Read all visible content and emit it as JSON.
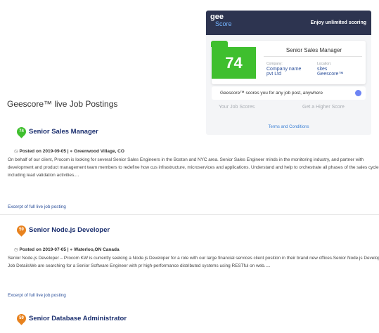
{
  "promo": {
    "logo_line1": "gee",
    "logo_line2": "Score",
    "tagline": "Enjoy unlimited scoring",
    "score": "74",
    "card_title": "Senior Sales Manager",
    "company_label": "Company:",
    "company_value_line1": "Company name",
    "company_value_line2": "pvt Ltd",
    "location_label": "Location:",
    "location_value_line1": "sites",
    "location_value_line2": "Geescore™",
    "note": "Geescore™ scores you for any job post, anywhere",
    "your_scores": "Your Job Scores",
    "higher_score": "Get a Higher Score",
    "terms": "Terms and Conditions",
    "colors": {
      "header": "#2d3450",
      "score_green": "#3fbf2e",
      "info_dot": "#6d84f4"
    }
  },
  "section_title": "Geescore™ live Job Postings",
  "jobs": [
    {
      "score": "74",
      "badge_color": "#3fbf2e",
      "title": "Senior Sales Manager",
      "date_prefix": "Posted on",
      "date": "2019-09-05",
      "separator": "|",
      "location": "Greenwood Village, CO",
      "description": "On behalf of our client, Procom is looking for several Senior Sales Engineers in the Boston and NYC area. Senior Sales Engineer minds in the monitoring industry, and partner with development and product management team members to redefine how cus infrastructure, microservices and applications. Understand and help to orchestrate all phases of the sales cycle, including lead validation activities....",
      "excerpt": "Excerpt of full live job posting"
    },
    {
      "score": "59",
      "badge_color": "#e8821e",
      "title": "Senior Node.js Developer",
      "date_prefix": "Posted on",
      "date": "2019-07-05",
      "separator": "|",
      "location": "Waterloo,ON Canada",
      "description": "Senior Node.js Developer – Procom KW is currently seeking a Node.js Developer for a role with our large financial services client position in their brand new offices.Senior Node.js Developer Job DetailsWe are searching for a Senior Software Engineer with pr high-performance distributed systems using RESTful on web.....",
      "excerpt": "Excerpt of full live job posting"
    },
    {
      "score": "59",
      "badge_color": "#e8821e",
      "title": "Senior Database Administrator"
    }
  ],
  "icons": {
    "clock": "clock-icon",
    "pin": "location-pin-icon",
    "info": "info-icon"
  }
}
